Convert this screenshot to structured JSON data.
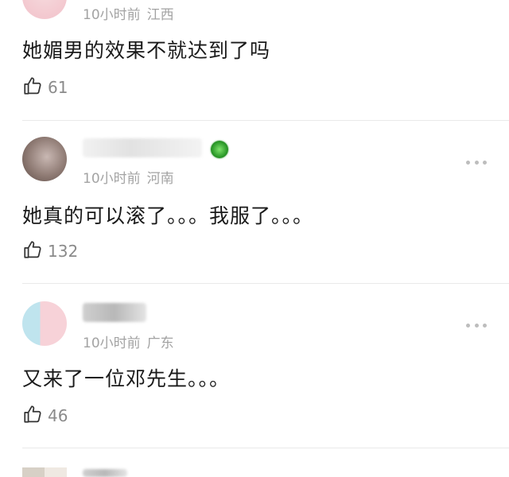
{
  "comments": [
    {
      "time": "10小时前",
      "location": "江西",
      "content": "她媚男的效果不就达到了吗",
      "likes": "61"
    },
    {
      "time": "10小时前",
      "location": "河南",
      "content": "她真的可以滚了。。。我服了。。。",
      "likes": "132"
    },
    {
      "time": "10小时前",
      "location": "广东",
      "content": "又来了一位邓先生。。。",
      "likes": "46"
    }
  ],
  "icons": {
    "like": "thumbs-up-icon",
    "more": "more-dots-icon",
    "badge": "green-badge-icon"
  },
  "colors": {
    "meta_text": "#a3a3a3",
    "divider": "#e9e9e9",
    "badge": "#2c9a29"
  }
}
